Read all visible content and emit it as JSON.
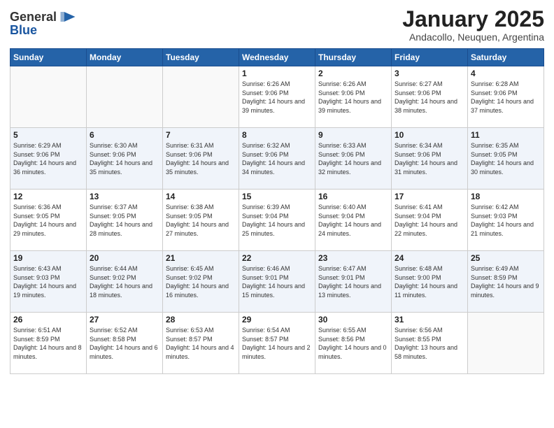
{
  "logo": {
    "general": "General",
    "blue": "Blue"
  },
  "title": "January 2025",
  "subtitle": "Andacollo, Neuquen, Argentina",
  "weekdays": [
    "Sunday",
    "Monday",
    "Tuesday",
    "Wednesday",
    "Thursday",
    "Friday",
    "Saturday"
  ],
  "rows": [
    [
      {
        "day": "",
        "sunrise": "",
        "sunset": "",
        "daylight": ""
      },
      {
        "day": "",
        "sunrise": "",
        "sunset": "",
        "daylight": ""
      },
      {
        "day": "",
        "sunrise": "",
        "sunset": "",
        "daylight": ""
      },
      {
        "day": "1",
        "sunrise": "Sunrise: 6:26 AM",
        "sunset": "Sunset: 9:06 PM",
        "daylight": "Daylight: 14 hours and 39 minutes."
      },
      {
        "day": "2",
        "sunrise": "Sunrise: 6:26 AM",
        "sunset": "Sunset: 9:06 PM",
        "daylight": "Daylight: 14 hours and 39 minutes."
      },
      {
        "day": "3",
        "sunrise": "Sunrise: 6:27 AM",
        "sunset": "Sunset: 9:06 PM",
        "daylight": "Daylight: 14 hours and 38 minutes."
      },
      {
        "day": "4",
        "sunrise": "Sunrise: 6:28 AM",
        "sunset": "Sunset: 9:06 PM",
        "daylight": "Daylight: 14 hours and 37 minutes."
      }
    ],
    [
      {
        "day": "5",
        "sunrise": "Sunrise: 6:29 AM",
        "sunset": "Sunset: 9:06 PM",
        "daylight": "Daylight: 14 hours and 36 minutes."
      },
      {
        "day": "6",
        "sunrise": "Sunrise: 6:30 AM",
        "sunset": "Sunset: 9:06 PM",
        "daylight": "Daylight: 14 hours and 35 minutes."
      },
      {
        "day": "7",
        "sunrise": "Sunrise: 6:31 AM",
        "sunset": "Sunset: 9:06 PM",
        "daylight": "Daylight: 14 hours and 35 minutes."
      },
      {
        "day": "8",
        "sunrise": "Sunrise: 6:32 AM",
        "sunset": "Sunset: 9:06 PM",
        "daylight": "Daylight: 14 hours and 34 minutes."
      },
      {
        "day": "9",
        "sunrise": "Sunrise: 6:33 AM",
        "sunset": "Sunset: 9:06 PM",
        "daylight": "Daylight: 14 hours and 32 minutes."
      },
      {
        "day": "10",
        "sunrise": "Sunrise: 6:34 AM",
        "sunset": "Sunset: 9:06 PM",
        "daylight": "Daylight: 14 hours and 31 minutes."
      },
      {
        "day": "11",
        "sunrise": "Sunrise: 6:35 AM",
        "sunset": "Sunset: 9:05 PM",
        "daylight": "Daylight: 14 hours and 30 minutes."
      }
    ],
    [
      {
        "day": "12",
        "sunrise": "Sunrise: 6:36 AM",
        "sunset": "Sunset: 9:05 PM",
        "daylight": "Daylight: 14 hours and 29 minutes."
      },
      {
        "day": "13",
        "sunrise": "Sunrise: 6:37 AM",
        "sunset": "Sunset: 9:05 PM",
        "daylight": "Daylight: 14 hours and 28 minutes."
      },
      {
        "day": "14",
        "sunrise": "Sunrise: 6:38 AM",
        "sunset": "Sunset: 9:05 PM",
        "daylight": "Daylight: 14 hours and 27 minutes."
      },
      {
        "day": "15",
        "sunrise": "Sunrise: 6:39 AM",
        "sunset": "Sunset: 9:04 PM",
        "daylight": "Daylight: 14 hours and 25 minutes."
      },
      {
        "day": "16",
        "sunrise": "Sunrise: 6:40 AM",
        "sunset": "Sunset: 9:04 PM",
        "daylight": "Daylight: 14 hours and 24 minutes."
      },
      {
        "day": "17",
        "sunrise": "Sunrise: 6:41 AM",
        "sunset": "Sunset: 9:04 PM",
        "daylight": "Daylight: 14 hours and 22 minutes."
      },
      {
        "day": "18",
        "sunrise": "Sunrise: 6:42 AM",
        "sunset": "Sunset: 9:03 PM",
        "daylight": "Daylight: 14 hours and 21 minutes."
      }
    ],
    [
      {
        "day": "19",
        "sunrise": "Sunrise: 6:43 AM",
        "sunset": "Sunset: 9:03 PM",
        "daylight": "Daylight: 14 hours and 19 minutes."
      },
      {
        "day": "20",
        "sunrise": "Sunrise: 6:44 AM",
        "sunset": "Sunset: 9:02 PM",
        "daylight": "Daylight: 14 hours and 18 minutes."
      },
      {
        "day": "21",
        "sunrise": "Sunrise: 6:45 AM",
        "sunset": "Sunset: 9:02 PM",
        "daylight": "Daylight: 14 hours and 16 minutes."
      },
      {
        "day": "22",
        "sunrise": "Sunrise: 6:46 AM",
        "sunset": "Sunset: 9:01 PM",
        "daylight": "Daylight: 14 hours and 15 minutes."
      },
      {
        "day": "23",
        "sunrise": "Sunrise: 6:47 AM",
        "sunset": "Sunset: 9:01 PM",
        "daylight": "Daylight: 14 hours and 13 minutes."
      },
      {
        "day": "24",
        "sunrise": "Sunrise: 6:48 AM",
        "sunset": "Sunset: 9:00 PM",
        "daylight": "Daylight: 14 hours and 11 minutes."
      },
      {
        "day": "25",
        "sunrise": "Sunrise: 6:49 AM",
        "sunset": "Sunset: 8:59 PM",
        "daylight": "Daylight: 14 hours and 9 minutes."
      }
    ],
    [
      {
        "day": "26",
        "sunrise": "Sunrise: 6:51 AM",
        "sunset": "Sunset: 8:59 PM",
        "daylight": "Daylight: 14 hours and 8 minutes."
      },
      {
        "day": "27",
        "sunrise": "Sunrise: 6:52 AM",
        "sunset": "Sunset: 8:58 PM",
        "daylight": "Daylight: 14 hours and 6 minutes."
      },
      {
        "day": "28",
        "sunrise": "Sunrise: 6:53 AM",
        "sunset": "Sunset: 8:57 PM",
        "daylight": "Daylight: 14 hours and 4 minutes."
      },
      {
        "day": "29",
        "sunrise": "Sunrise: 6:54 AM",
        "sunset": "Sunset: 8:57 PM",
        "daylight": "Daylight: 14 hours and 2 minutes."
      },
      {
        "day": "30",
        "sunrise": "Sunrise: 6:55 AM",
        "sunset": "Sunset: 8:56 PM",
        "daylight": "Daylight: 14 hours and 0 minutes."
      },
      {
        "day": "31",
        "sunrise": "Sunrise: 6:56 AM",
        "sunset": "Sunset: 8:55 PM",
        "daylight": "Daylight: 13 hours and 58 minutes."
      },
      {
        "day": "",
        "sunrise": "",
        "sunset": "",
        "daylight": ""
      }
    ]
  ]
}
